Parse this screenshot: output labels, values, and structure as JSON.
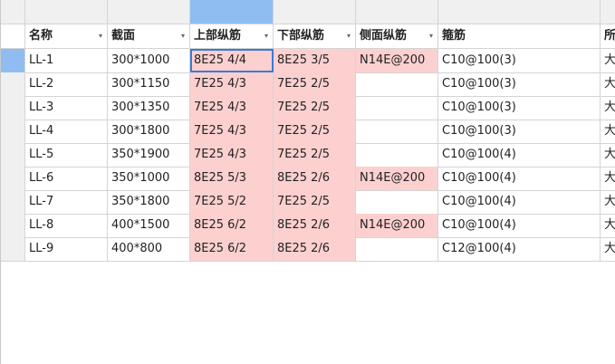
{
  "columns": [
    {
      "label": "名称"
    },
    {
      "label": "截面"
    },
    {
      "label": "上部纵筋"
    },
    {
      "label": "下部纵筋"
    },
    {
      "label": "侧面纵筋"
    },
    {
      "label": "箍筋"
    },
    {
      "label": "所"
    }
  ],
  "dropdown_glyph": "▾",
  "colors": {
    "highlight": "#fdd0d0",
    "selection": "#8fbdf2"
  },
  "rows": [
    {
      "name": "LL-1",
      "section": "300*1000",
      "top": "8E25 4/4",
      "bottom": "8E25 3/5",
      "side": "N14E@200",
      "stirrup": "C10@100(3)",
      "extra": "大"
    },
    {
      "name": "LL-2",
      "section": "300*1150",
      "top": "7E25 4/3",
      "bottom": "7E25 2/5",
      "side": "",
      "stirrup": "C10@100(3)",
      "extra": "大"
    },
    {
      "name": "LL-3",
      "section": "300*1350",
      "top": "7E25 4/3",
      "bottom": "7E25 2/5",
      "side": "",
      "stirrup": "C10@100(3)",
      "extra": "大"
    },
    {
      "name": "LL-4",
      "section": "300*1800",
      "top": "7E25 4/3",
      "bottom": "7E25 2/5",
      "side": "",
      "stirrup": "C10@100(3)",
      "extra": "大"
    },
    {
      "name": "LL-5",
      "section": "350*1900",
      "top": "7E25 4/3",
      "bottom": "7E25 2/5",
      "side": "",
      "stirrup": "C10@100(4)",
      "extra": "大"
    },
    {
      "name": "LL-6",
      "section": "350*1000",
      "top": "8E25 5/3",
      "bottom": "8E25 2/6",
      "side": "N14E@200",
      "stirrup": "C10@100(4)",
      "extra": "大"
    },
    {
      "name": "LL-7",
      "section": "350*1800",
      "top": "7E25 5/2",
      "bottom": "7E25 2/5",
      "side": "",
      "stirrup": "C10@100(4)",
      "extra": "大"
    },
    {
      "name": "LL-8",
      "section": "400*1500",
      "top": "8E25 6/2",
      "bottom": "8E25 2/6",
      "side": "N14E@200",
      "stirrup": "C10@100(4)",
      "extra": "大"
    },
    {
      "name": "LL-9",
      "section": "400*800",
      "top": "8E25 6/2",
      "bottom": "8E25 2/6",
      "side": "",
      "stirrup": "C12@100(4)",
      "extra": "大"
    }
  ]
}
